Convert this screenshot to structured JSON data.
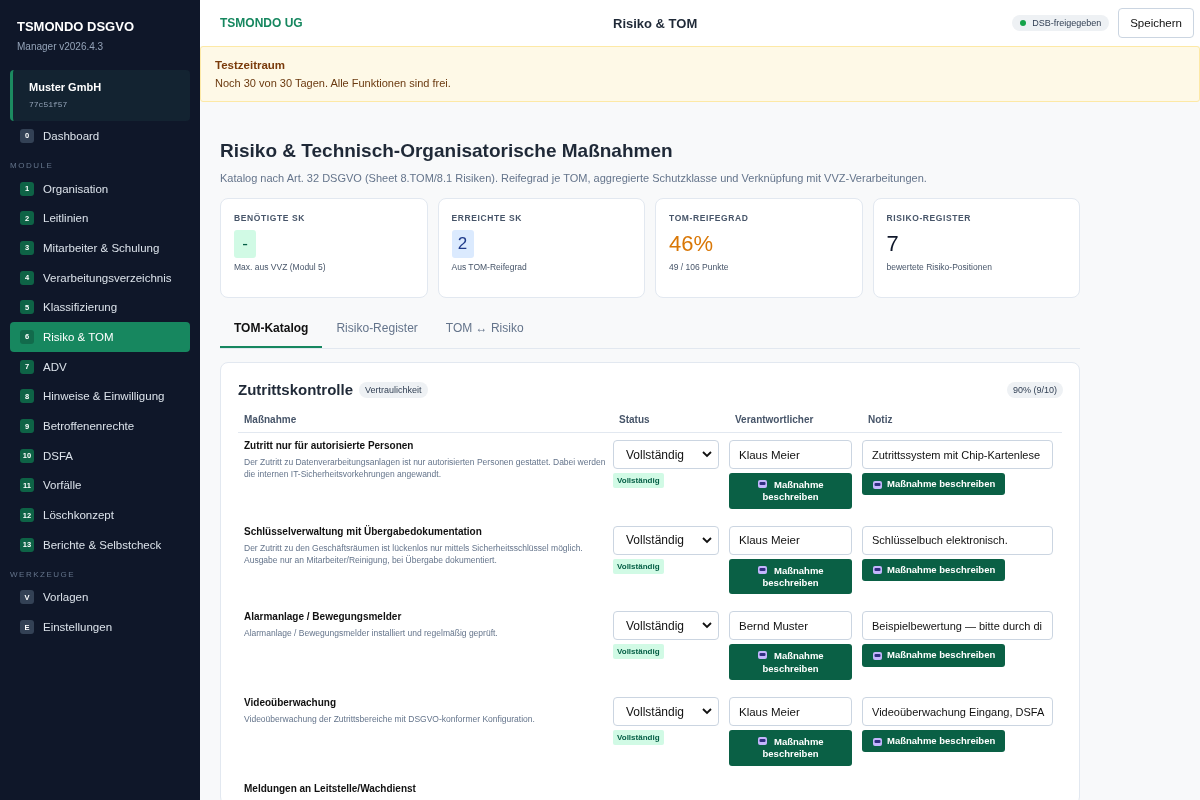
{
  "sidebar": {
    "brand": "TSMONDO DSGVO",
    "version": "Manager v2026.4.3",
    "company": {
      "name": "Muster GmbH",
      "id": "77c51f57"
    },
    "sections": [
      {
        "kind": "general",
        "items": [
          {
            "badge": "0",
            "label": "Dashboard",
            "selected": false
          }
        ]
      },
      {
        "kind": "module",
        "title": "MODULE",
        "items": [
          {
            "badge": "1",
            "label": "Organisation",
            "selected": false
          },
          {
            "badge": "2",
            "label": "Leitlinien",
            "selected": false
          },
          {
            "badge": "3",
            "label": "Mitarbeiter & Schulung",
            "selected": false
          },
          {
            "badge": "4",
            "label": "Verarbeitungsverzeichnis",
            "selected": false
          },
          {
            "badge": "5",
            "label": "Klassifizierung",
            "selected": false
          },
          {
            "badge": "6",
            "label": "Risiko & TOM",
            "selected": true
          },
          {
            "badge": "7",
            "label": "ADV",
            "selected": false
          },
          {
            "badge": "8",
            "label": "Hinweise & Einwilligung",
            "selected": false
          },
          {
            "badge": "9",
            "label": "Betroffenenrechte",
            "selected": false
          },
          {
            "badge": "10",
            "label": "DSFA",
            "selected": false
          },
          {
            "badge": "11",
            "label": "Vorfälle",
            "selected": false
          },
          {
            "badge": "12",
            "label": "Löschkonzept",
            "selected": false
          },
          {
            "badge": "13",
            "label": "Berichte & Selbstcheck",
            "selected": false
          }
        ]
      },
      {
        "kind": "tool",
        "title": "WERKZEUGE",
        "items": [
          {
            "badge": "V",
            "label": "Vorlagen",
            "selected": false
          },
          {
            "badge": "E",
            "label": "Einstellungen",
            "selected": false
          }
        ]
      }
    ]
  },
  "header": {
    "org": "TSMONDO UG",
    "title": "Risiko & TOM",
    "status": {
      "label": "DSB-freigegeben",
      "color": "#16a34a"
    },
    "save": "Speichern"
  },
  "banner": {
    "title": "Testzeitraum",
    "text": "Noch 30 von 30 Tagen. Alle Funktionen sind frei."
  },
  "page": {
    "title": "Risiko & Technisch-Organisatorische Maßnahmen",
    "subtitle": "Katalog nach Art. 32 DSGVO (Sheet 8.TOM/8.1 Risiken). Reifegrad je TOM, aggregierte Schutzklasse und Verknüpfung mit VVZ-Verarbeitungen."
  },
  "stats": [
    {
      "kind": "badge-green",
      "label": "BENÖTIGTE SK",
      "value": "-",
      "note": "Max. aus VVZ (Modul 5)"
    },
    {
      "kind": "badge-blue",
      "label": "ERREICHTE SK",
      "value": "2",
      "note": "Aus TOM-Reifegrad"
    },
    {
      "kind": "warning",
      "label": "TOM-REIFEGRAD",
      "value": "46%",
      "note": "49 / 106 Punkte"
    },
    {
      "kind": "plain",
      "label": "RISIKO-REGISTER",
      "value": "7",
      "note": "bewertete Risiko-Positionen"
    }
  ],
  "tabs": [
    {
      "label": "TOM-Katalog",
      "selected": true
    },
    {
      "label": "Risiko-Register",
      "selected": false
    },
    {
      "label": "TOM ↔ Risiko",
      "selected": false
    }
  ],
  "catalog": {
    "title": "Zutrittskontrolle",
    "tag": "Vertraulichkeit",
    "score": "90% (9/10)",
    "columns": [
      "Maßnahme",
      "Status",
      "Verantwortlicher",
      "Notiz"
    ],
    "rows": [
      {
        "title": "Zutritt nur für autorisierte Personen",
        "description": "Der Zutritt zu Datenverarbeitungsanlagen ist nur autorisierten Personen gestattet. Dabei werden die internen IT-Sicherheitsvorkehrungen angewandt.",
        "status": "Vollständig",
        "status_badge": "Vollständig",
        "owner": "Klaus Meier",
        "note": "Zutrittssystem mit Chip-Kartenlese",
        "owner_action": "Maßnahme beschreiben",
        "note_action": "Maßnahme beschreiben"
      },
      {
        "title": "Schlüsselverwaltung mit Übergabedokumentation",
        "description": "Der Zutritt zu den Geschäftsräumen ist lückenlos nur mittels Sicherheitsschlüssel möglich. Ausgabe nur an Mitarbeiter/Reinigung, bei Übergabe dokumentiert.",
        "status": "Vollständig",
        "status_badge": "Vollständig",
        "owner": "Klaus Meier",
        "note": "Schlüsselbuch elektronisch.",
        "owner_action": "Maßnahme beschreiben",
        "note_action": "Maßnahme beschreiben"
      },
      {
        "title": "Alarmanlage / Bewegungsmelder",
        "description": "Alarmanlage / Bewegungsmelder installiert und regelmäßig geprüft.",
        "status": "Vollständig",
        "status_badge": "Vollständig",
        "owner": "Bernd Muster",
        "note": "Beispielbewertung — bitte durch di",
        "owner_action": "Maßnahme beschreiben",
        "note_action": "Maßnahme beschreiben"
      },
      {
        "title": "Videoüberwachung",
        "description": "Videoüberwachung der Zutrittsbereiche mit DSGVO-konformer Konfiguration.",
        "status": "Vollständig",
        "status_badge": "Vollständig",
        "owner": "Klaus Meier",
        "note": "Videoüberwachung Eingang, DSFA",
        "owner_action": "Maßnahme beschreiben",
        "note_action": "Maßnahme beschreiben"
      },
      {
        "title": "Meldungen an Leitstelle/Wachdienst"
      }
    ]
  }
}
